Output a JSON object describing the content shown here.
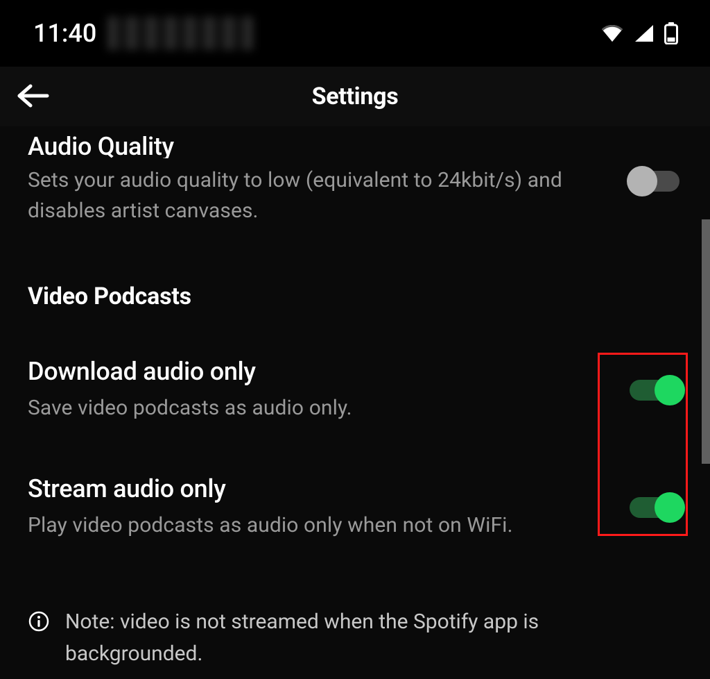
{
  "status": {
    "time": "11:40"
  },
  "header": {
    "title": "Settings"
  },
  "settings": {
    "audio_quality": {
      "title": "Audio Quality",
      "desc": "Sets your audio quality to low (equivalent to 24kbit/s) and disables artist canvases.",
      "enabled": false
    },
    "video_podcasts": {
      "section_label": "Video Podcasts",
      "download_audio_only": {
        "title": "Download audio only",
        "desc": "Save video podcasts as audio only.",
        "enabled": true
      },
      "stream_audio_only": {
        "title": "Stream audio only",
        "desc": "Play video podcasts as audio only when not on WiFi.",
        "enabled": true
      },
      "note": "Note: video is not streamed when the Spotify app is backgrounded."
    }
  },
  "colors": {
    "accent_green": "#1ed760",
    "annotation_red": "#ff1a1a"
  }
}
